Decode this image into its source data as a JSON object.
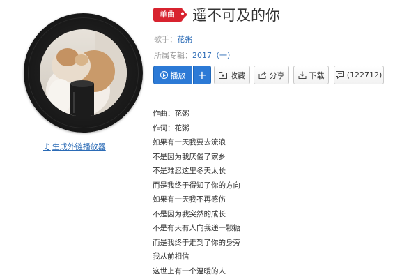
{
  "song": {
    "badge": "单曲",
    "title": "遥不可及的你",
    "artist_label": "歌手：",
    "artist": "花粥",
    "album_label": "所属专辑：",
    "album": "2017（一）"
  },
  "actions": {
    "play_label": "播放",
    "add_label": "+",
    "favorite_label": "收藏",
    "share_label": "分享",
    "download_label": "下载",
    "comment_count": "(122712)"
  },
  "external_player_label": "生成外链播放器",
  "lyrics": [
    "作曲：花粥",
    "作词：花粥",
    "如果有一天我要去流浪",
    "不是因为我厌倦了家乡",
    "不是难忍这里冬天太长",
    "而是我终于得知了你的方向",
    "如果有一天我不再感伤",
    "不是因为我突然的成长",
    "不是有天有人向我递一颗糖",
    "而是我终于走到了你的身旁",
    "我从前相信",
    "这世上有一个温暖的人"
  ],
  "colors": {
    "accent_blue": "#2c7ad6",
    "link_blue": "#2b6bb6",
    "badge_red": "#d8232f"
  },
  "icons": [
    "play-icon",
    "folder-plus-icon",
    "share-icon",
    "download-icon",
    "comment-icon",
    "music-note-icon"
  ]
}
